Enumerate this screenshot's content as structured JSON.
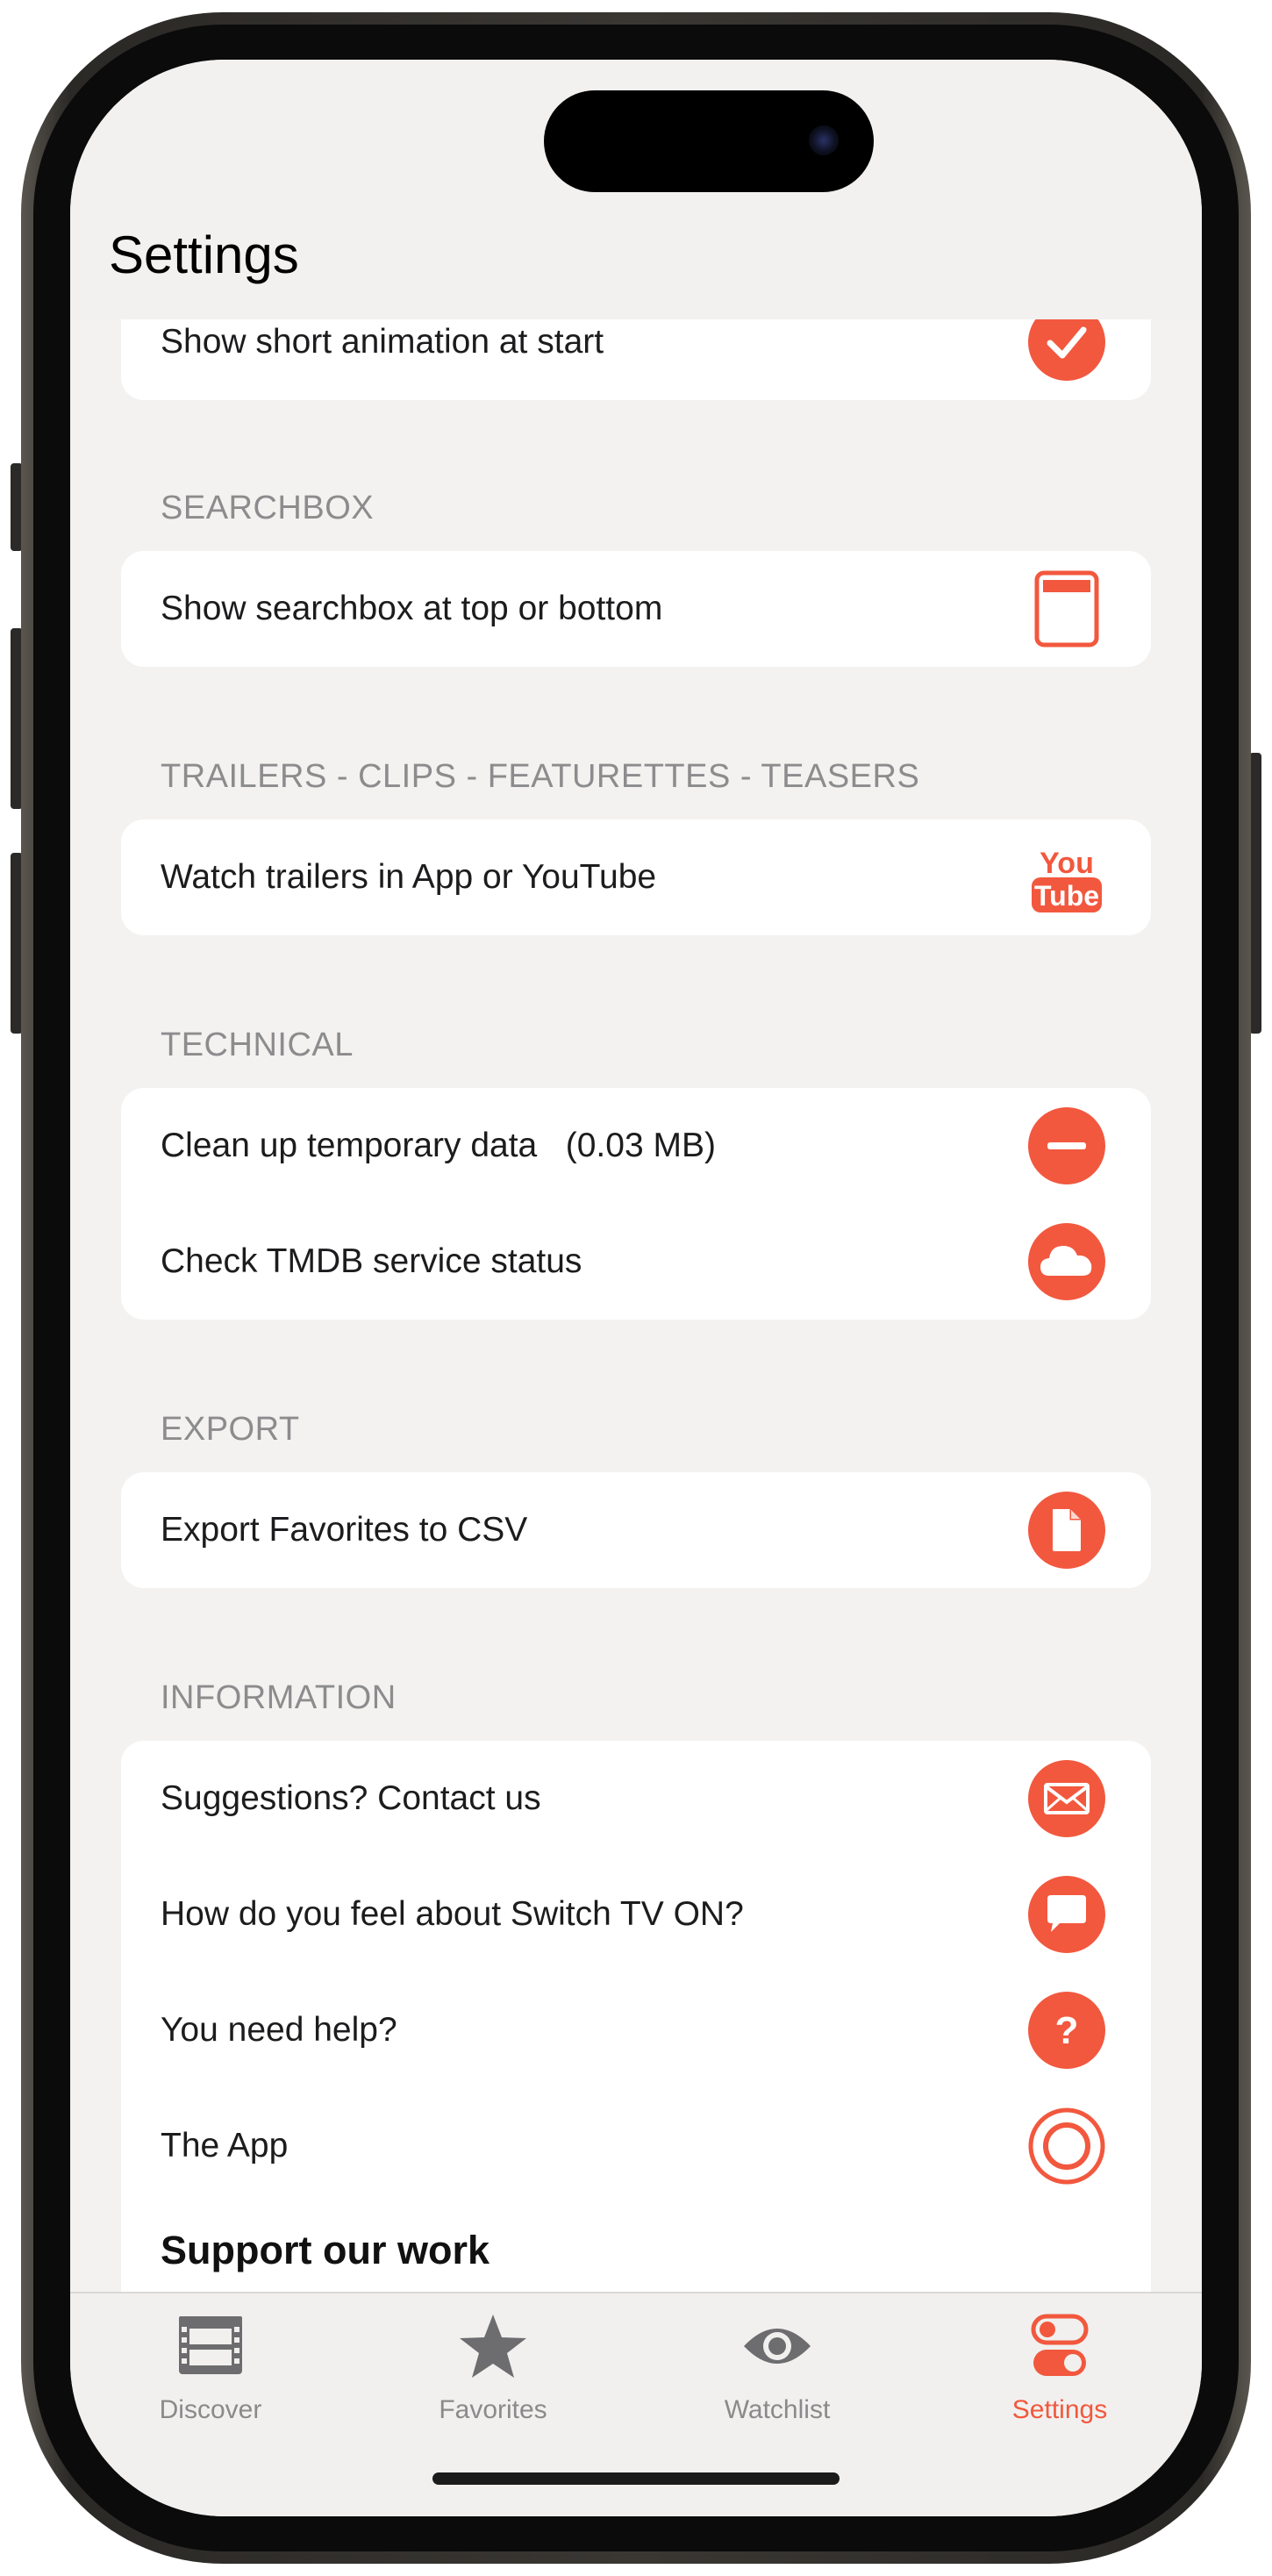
{
  "header": {
    "title": "Settings"
  },
  "rows_top": {
    "animation_label": "Show short animation at start"
  },
  "sections": {
    "searchbox": {
      "header": "SEARCHBOX",
      "row_label": "Show searchbox at top or bottom"
    },
    "trailers": {
      "header": "TRAILERS - CLIPS - FEATURETTES - TEASERS",
      "row_label": "Watch trailers in App or YouTube",
      "youtube_top": "You",
      "youtube_bottom": "Tube"
    },
    "technical": {
      "header": "TECHNICAL",
      "cleanup_label": "Clean up temporary data   (0.03 MB)",
      "tmdb_label": "Check TMDB service status"
    },
    "export": {
      "header": "EXPORT",
      "row_label": "Export Favorites to CSV"
    },
    "information": {
      "header": "INFORMATION",
      "contact_label": "Suggestions? Contact us",
      "feel_label": "How do you feel about Switch TV ON?",
      "help_label": "You need help?",
      "app_label": "The App",
      "support_label": "Support our work"
    }
  },
  "tabbar": {
    "tabs": [
      {
        "label": "Discover",
        "icon": "film-icon"
      },
      {
        "label": "Favorites",
        "icon": "star-icon"
      },
      {
        "label": "Watchlist",
        "icon": "eye-icon"
      },
      {
        "label": "Settings",
        "icon": "toggles-icon",
        "active": true
      }
    ]
  },
  "colors": {
    "accent": "#f2583e",
    "background": "#f3f2f0",
    "card": "#ffffff",
    "section_text": "#8c8c8e"
  }
}
